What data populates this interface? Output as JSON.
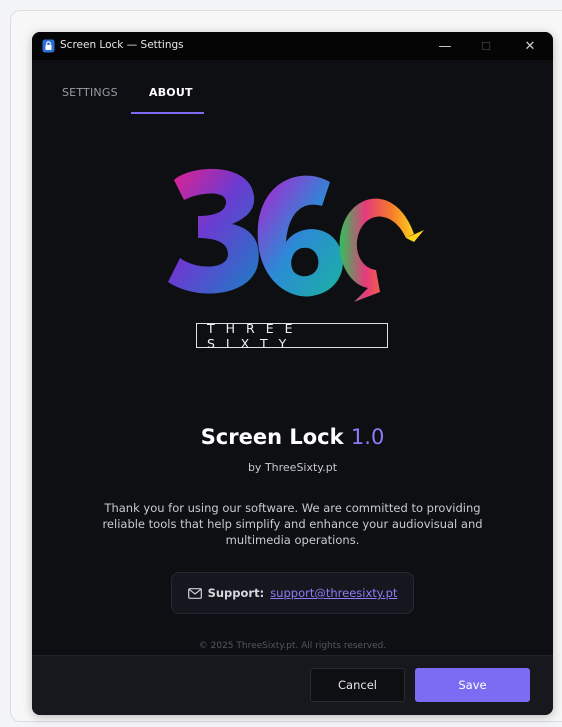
{
  "window": {
    "title": "Screen Lock — Settings",
    "controls": {
      "minimize": "—",
      "maximize": "☐",
      "close": "✕"
    }
  },
  "tabs": [
    {
      "label": "SETTINGS",
      "active": false
    },
    {
      "label": "ABOUT",
      "active": true
    }
  ],
  "brand": {
    "logo_icon": "three-sixty-logo-icon",
    "wordmark": "THREE SIXTY"
  },
  "about": {
    "product_name": "Screen Lock",
    "version": "1.0",
    "byline": "by ThreeSixty.pt",
    "description": "Thank you for using our software. We are committed to providing reliable tools that help simplify and enhance your audiovisual and multimedia operations.",
    "support_label": "Support:",
    "support_email": "support@threesixty.pt",
    "support_icon": "mail-icon",
    "copyright": "© 2025 ThreeSixty.pt. All rights reserved."
  },
  "footer": {
    "cancel_label": "Cancel",
    "save_label": "Save"
  },
  "colors": {
    "accent": "#7c6cf4",
    "background": "#0e0f13",
    "footer": "#17181d"
  }
}
